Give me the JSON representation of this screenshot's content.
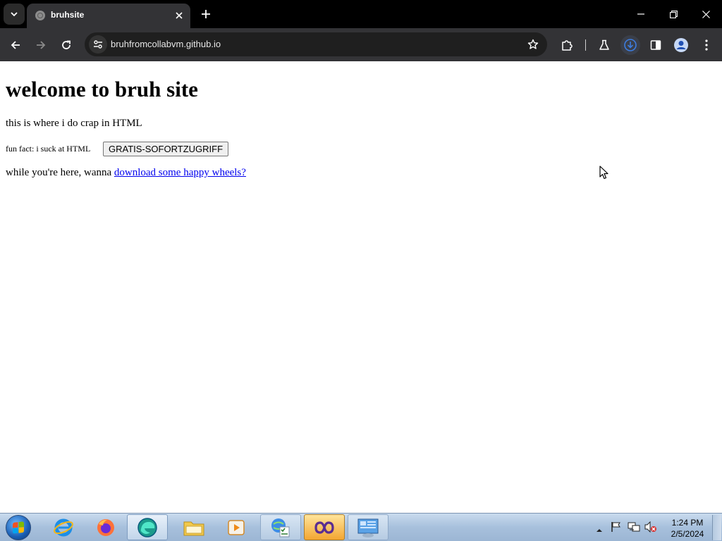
{
  "browser": {
    "tab_title": "bruhsite",
    "url": "bruhfromcollabvm.github.io"
  },
  "page": {
    "heading": "welcome to bruh site",
    "paragraph1": "this is where i do crap in HTML",
    "fun_fact": "fun fact: i suck at HTML",
    "button_label": "GRATIS-SOFORTZUGRIFF",
    "paragraph3_text": "while you're here, wanna ",
    "link_text": "download some happy wheels?"
  },
  "taskbar": {
    "time": "1:24 PM",
    "date": "2/5/2024",
    "apps": [
      "internet-explorer",
      "firefox",
      "edge",
      "file-explorer",
      "media-player",
      "windows-update",
      "visual-studio",
      "control-panel"
    ]
  },
  "colors": {
    "chrome_bg": "#333336",
    "titlebar_bg": "#000000",
    "link": "#0000ee"
  }
}
